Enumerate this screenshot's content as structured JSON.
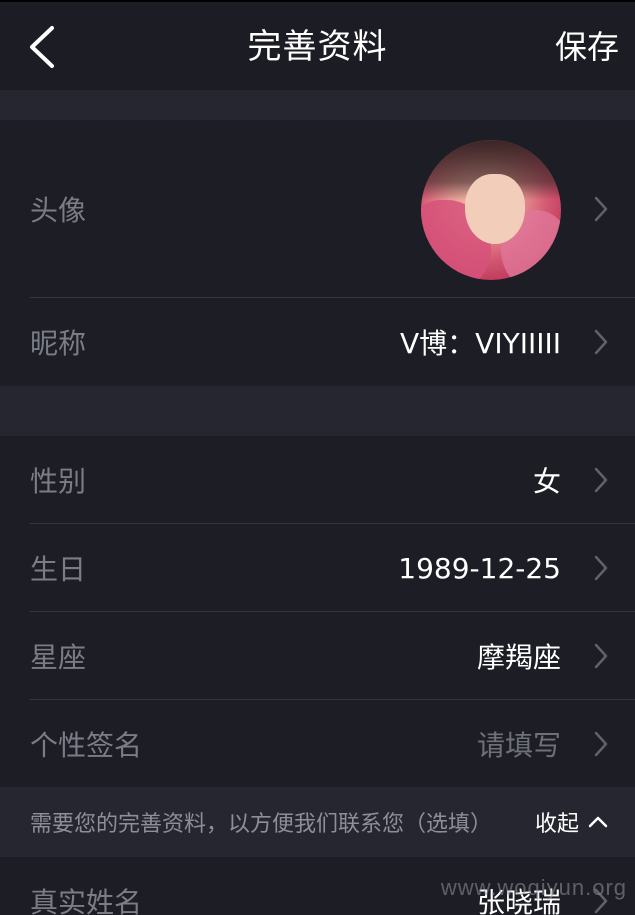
{
  "header": {
    "title": "完善资料",
    "save_label": "保存"
  },
  "profile": {
    "avatar_label": "头像",
    "nickname_label": "昵称",
    "nickname_value": "V博：VIYIIIII"
  },
  "details": {
    "gender_label": "性别",
    "gender_value": "女",
    "birthday_label": "生日",
    "birthday_value": "1989-12-25",
    "zodiac_label": "星座",
    "zodiac_value": "摩羯座",
    "signature_label": "个性签名",
    "signature_placeholder": "请填写"
  },
  "notice": {
    "text": "需要您的完善资料，以方便我们联系您（选填）",
    "collapse_label": "收起"
  },
  "extra": {
    "real_name_label": "真实姓名",
    "real_name_value": "张晓瑞"
  },
  "watermark": "www.woqiyun.org",
  "icons": [
    "back-arrow-icon",
    "chevron-right-icon",
    "chevron-up-icon"
  ]
}
